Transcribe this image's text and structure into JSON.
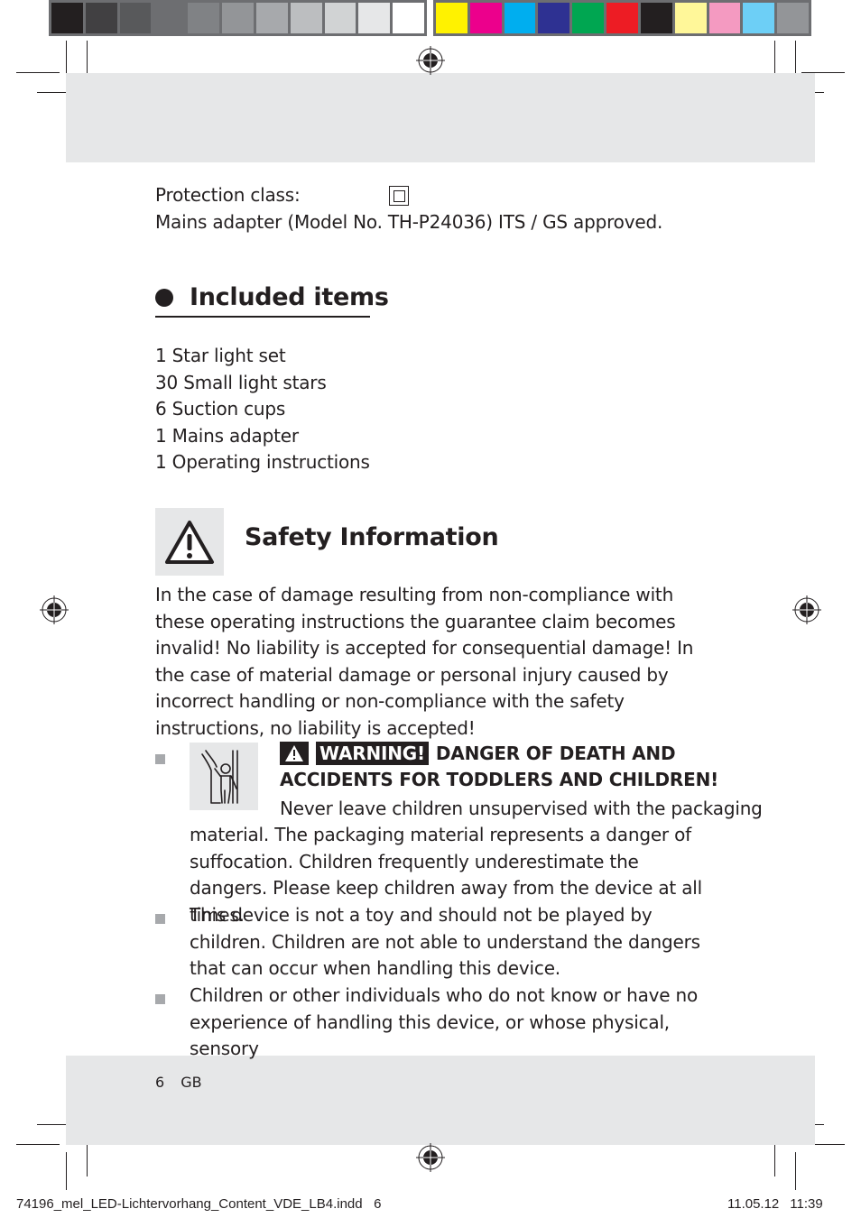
{
  "colorbar": {
    "gray_swatches": [
      "#231f20",
      "#414042",
      "#58595b",
      "#6d6e71",
      "#808285",
      "#939598",
      "#a7a9ac",
      "#bcbec0",
      "#d1d3d4",
      "#e6e7e8",
      "#ffffff"
    ],
    "color_swatches": [
      "#fff200",
      "#ec008c",
      "#00aeef",
      "#2e3192",
      "#00a651",
      "#ed1c24",
      "#231f20",
      "#fff799",
      "#f49ac1",
      "#6dcff6",
      "#939598"
    ]
  },
  "specs": {
    "protection_label": "Protection class:",
    "protection_symbol": "class-II-double-square-icon",
    "adapter_line": "Mains adapter (Model No. TH-P24036) ITS / GS approved."
  },
  "included": {
    "title": "Included items",
    "items": [
      "1 Star light set",
      "30 Small light stars",
      "6 Suction cups",
      "1 Mains adapter",
      "1 Operating instructions"
    ]
  },
  "safety": {
    "icon": "warning-triangle-icon",
    "title": "Safety Information",
    "intro": "In the case of damage resulting from non-compliance with these operating instructions the guarantee claim becomes invalid! No liability is accepted for consequential damage! In the case of material damage or personal injury caused by incorrect handling or non-compliance with the safety instructions, no liability is accepted!",
    "warning": {
      "icon": "child-danger-icon",
      "label": "WARNING!",
      "heading_line1": "DANGER OF DEATH AND",
      "heading_line2": "ACCIDENTS FOR TODDLERS AND CHILDREN!",
      "body_line1": "Never leave children unsupervised with the packaging",
      "body_rest": "material. The packaging material represents a danger of suffocation. Children frequently underestimate the dangers. Please keep children away from the device at all times."
    },
    "bullets": [
      "This device is not a toy and should not be played by children. Children are not able to understand the dangers that can occur when handling this device.",
      "Children or other individuals who do not know or have no experience of handling this device, or whose physical, sensory"
    ]
  },
  "footer": {
    "page_number": "6",
    "language": "GB"
  },
  "slug": {
    "filename": "74196_mel_LED-Lichtervorhang_Content_VDE_LB4.indd   6",
    "date": "11.05.12",
    "time": "11:39"
  }
}
